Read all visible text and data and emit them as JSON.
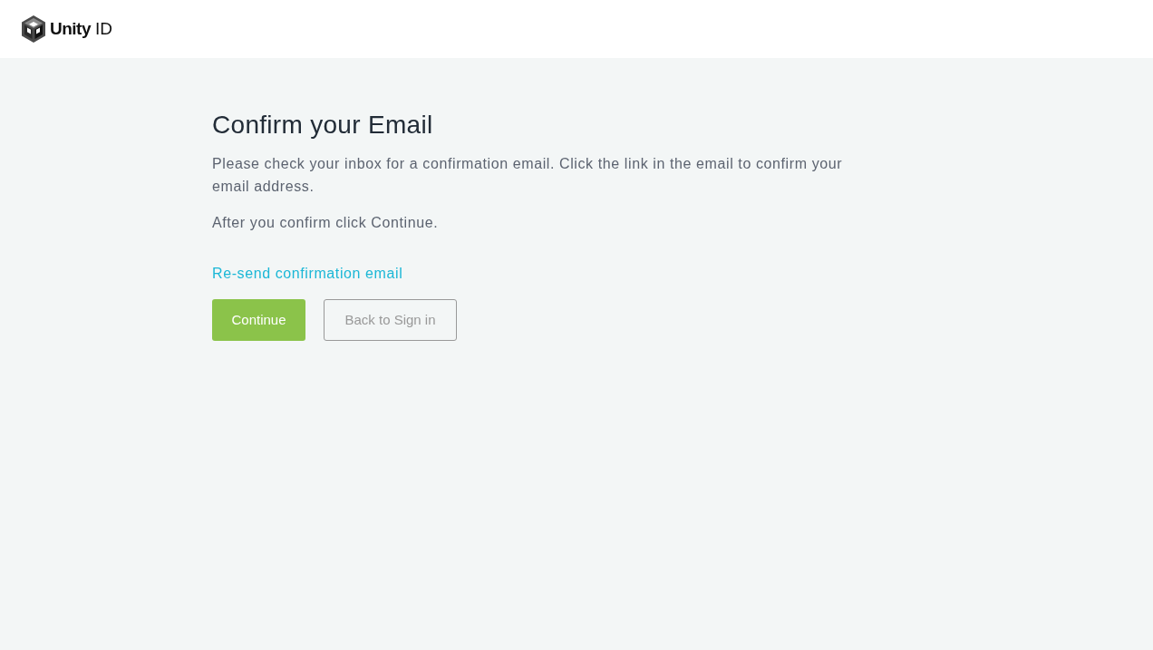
{
  "header": {
    "brand": "Unity",
    "brand_suffix": "ID"
  },
  "main": {
    "title": "Confirm your Email",
    "paragraphs": [
      "Please check your inbox for a confirmation email. Click the link in the email to confirm your email address.",
      "After you confirm click Continue."
    ],
    "resend_link": "Re-send confirmation email",
    "buttons": [
      {
        "label": "Continue",
        "kind": "primary"
      },
      {
        "label": "Back to Sign in",
        "kind": "secondary"
      }
    ]
  }
}
